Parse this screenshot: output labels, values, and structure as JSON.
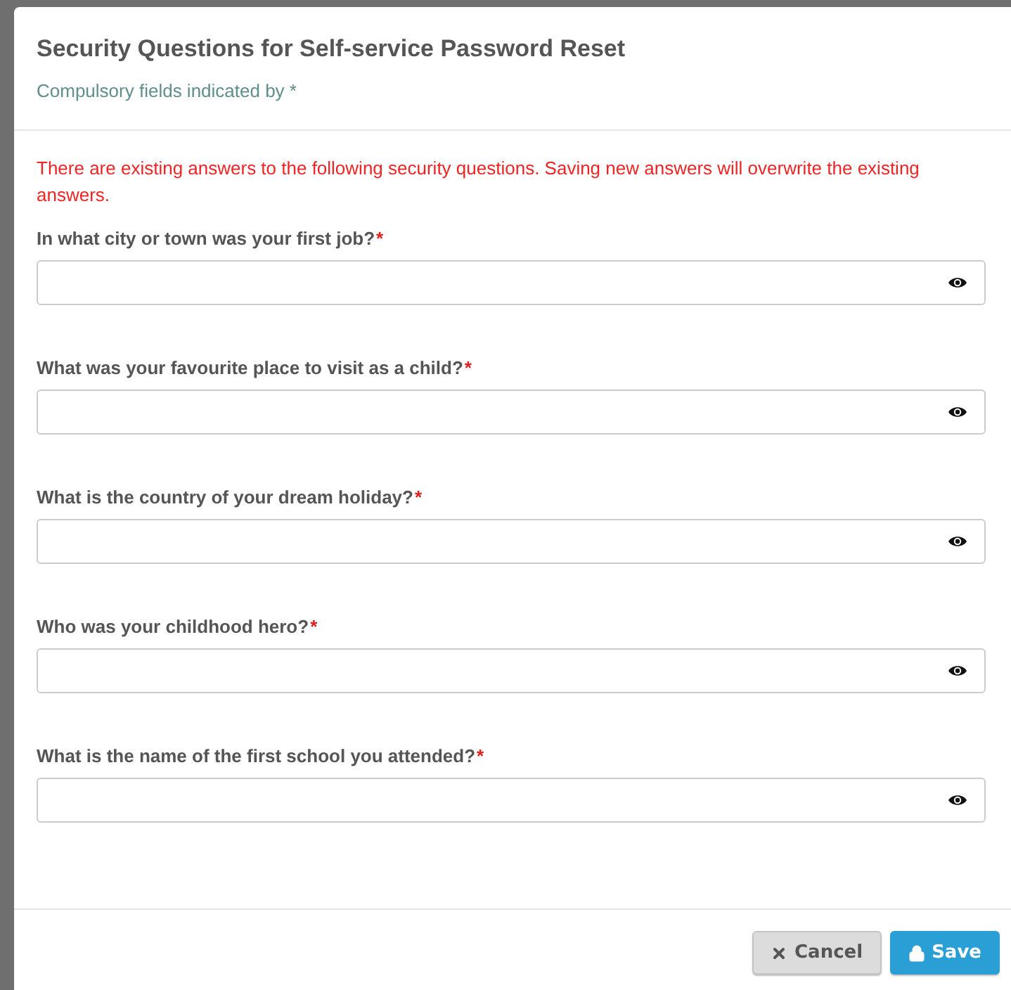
{
  "dialog": {
    "title": "Security Questions for Self-service Password Reset",
    "subtitle": "Compulsory fields indicated by *"
  },
  "warning": "There are existing answers to the following security questions. Saving new answers will overwrite the existing answers.",
  "questions": [
    {
      "label": "In what city or town was your first job?",
      "marker": "*"
    },
    {
      "label": "What was your favourite place to visit as a child?",
      "marker": "*"
    },
    {
      "label": "What is the country of your dream holiday?",
      "marker": "*"
    },
    {
      "label": "Who was your childhood hero?",
      "marker": "*"
    },
    {
      "label": "What is the name of the first school you attended?",
      "marker": "*"
    }
  ],
  "buttons": [
    {
      "label": "Cancel",
      "kind": "cancel"
    },
    {
      "label": "Save",
      "kind": "save"
    }
  ]
}
